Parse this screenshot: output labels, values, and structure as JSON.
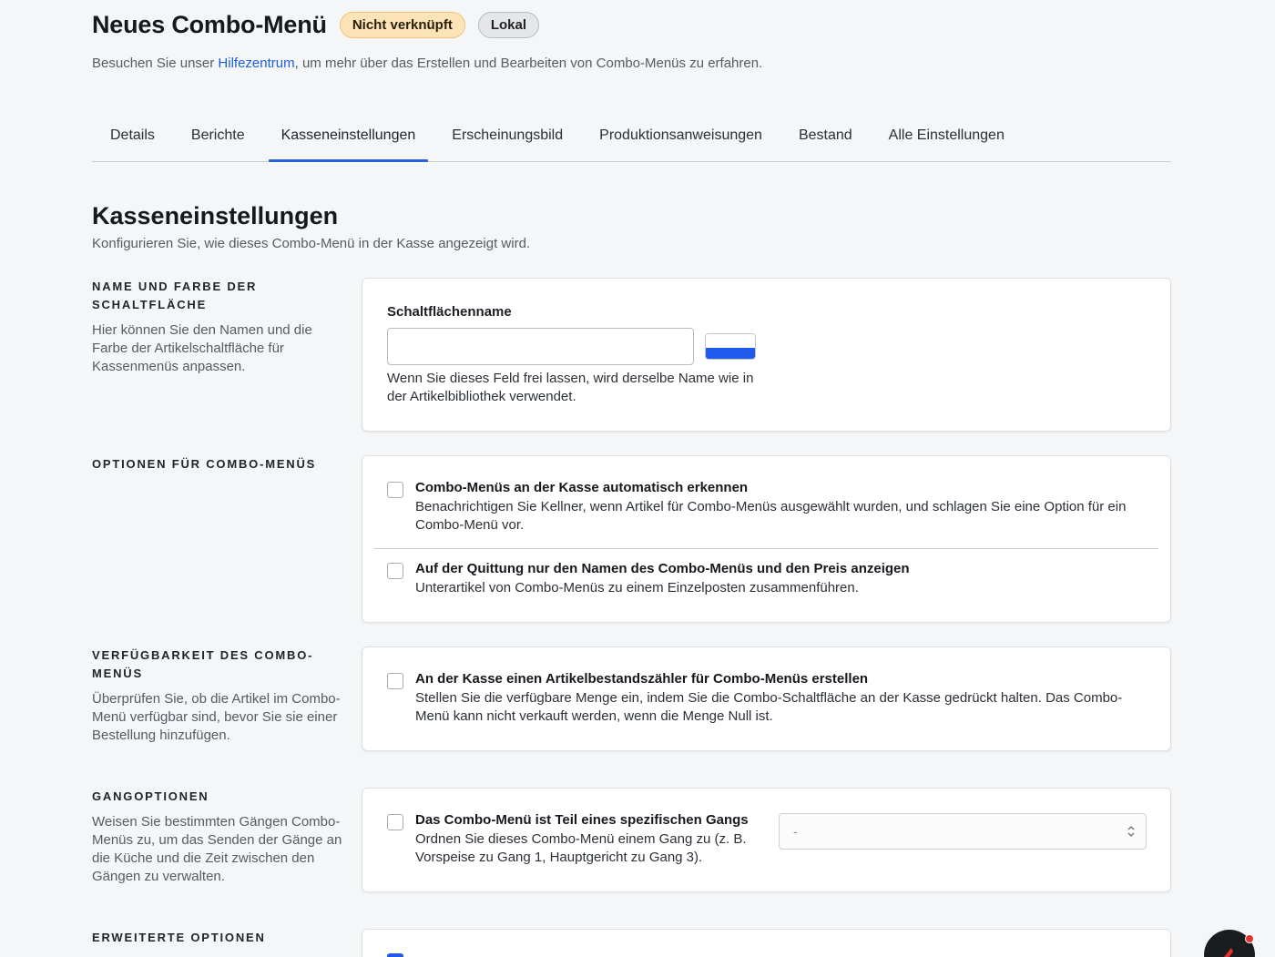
{
  "header": {
    "title": "Neues Combo-Menü",
    "badge_status": "Nicht verknüpft",
    "badge_scope": "Lokal",
    "help_prefix": "Besuchen Sie unser ",
    "help_link": "Hilfezentrum",
    "help_suffix": ", um mehr über das Erstellen und Bearbeiten von Combo-Menüs zu erfahren."
  },
  "tabs": [
    {
      "label": "Details"
    },
    {
      "label": "Berichte"
    },
    {
      "label": "Kasseneinstellungen",
      "active": true
    },
    {
      "label": "Erscheinungsbild"
    },
    {
      "label": "Produktionsanweisungen"
    },
    {
      "label": "Bestand"
    },
    {
      "label": "Alle Einstellungen"
    }
  ],
  "section": {
    "title": "Kasseneinstellungen",
    "subtitle": "Konfigurieren Sie, wie dieses Combo-Menü in der Kasse angezeigt wird."
  },
  "button_name": {
    "heading": "NAME UND FARBE DER SCHALTFLÄCHE",
    "description": "Hier können Sie den Namen und die Farbe der Artikelschaltfläche für Kassenmenüs anpassen.",
    "field_label": "Schaltflächenname",
    "field_value": "",
    "field_help": "Wenn Sie dieses Feld frei lassen, wird derselbe Name wie in der Artikelbibliothek verwendet.",
    "color": "#1f5bea"
  },
  "combo_options": {
    "heading": "OPTIONEN FÜR COMBO-MENÜS",
    "options": [
      {
        "title": "Combo-Menüs an der Kasse automatisch erkennen",
        "description": "Benachrichtigen Sie Kellner, wenn Artikel für Combo-Menüs ausgewählt wurden, und schlagen Sie eine Option für ein Combo-Menü vor.",
        "checked": false
      },
      {
        "title": "Auf der Quittung nur den Namen des Combo-Menüs und den Preis anzeigen",
        "description": "Unterartikel von Combo-Menüs zu einem Einzelposten zusammenführen.",
        "checked": false
      }
    ]
  },
  "availability": {
    "heading": "VERFÜGBARKEIT DES COMBO-MENÜS",
    "description": "Überprüfen Sie, ob die Artikel im Combo-Menü verfügbar sind, bevor Sie sie einer Bestellung hinzufügen.",
    "option": {
      "title": "An der Kasse einen Artikelbestandszähler für Combo-Menüs erstellen",
      "description": "Stellen Sie die verfügbare Menge ein, indem Sie die Combo-Schaltfläche an der Kasse gedrückt halten. Das Combo-Menü kann nicht verkauft werden, wenn die Menge Null ist.",
      "checked": false
    }
  },
  "courses": {
    "heading": "GANGOPTIONEN",
    "description": "Weisen Sie bestimmten Gängen Combo-Menüs zu, um das Senden der Gänge an die Küche und die Zeit zwischen den Gängen zu verwalten.",
    "option": {
      "title": "Das Combo-Menü ist Teil eines spezifischen Gangs",
      "description": "Ordnen Sie dieses Combo-Menü einem Gang zu (z. B. Vorspeise zu Gang 1, Hauptgericht zu Gang 3).",
      "checked": false
    },
    "select_value": "-"
  },
  "advanced": {
    "heading": "ERWEITERTE OPTIONEN"
  },
  "colors": {
    "accent": "#2563d9",
    "badge_warn_bg": "#fde3b8",
    "badge_local_bg": "#e4e6e9",
    "fab": "#1b1c1f",
    "fab_notification": "#e5322d"
  }
}
